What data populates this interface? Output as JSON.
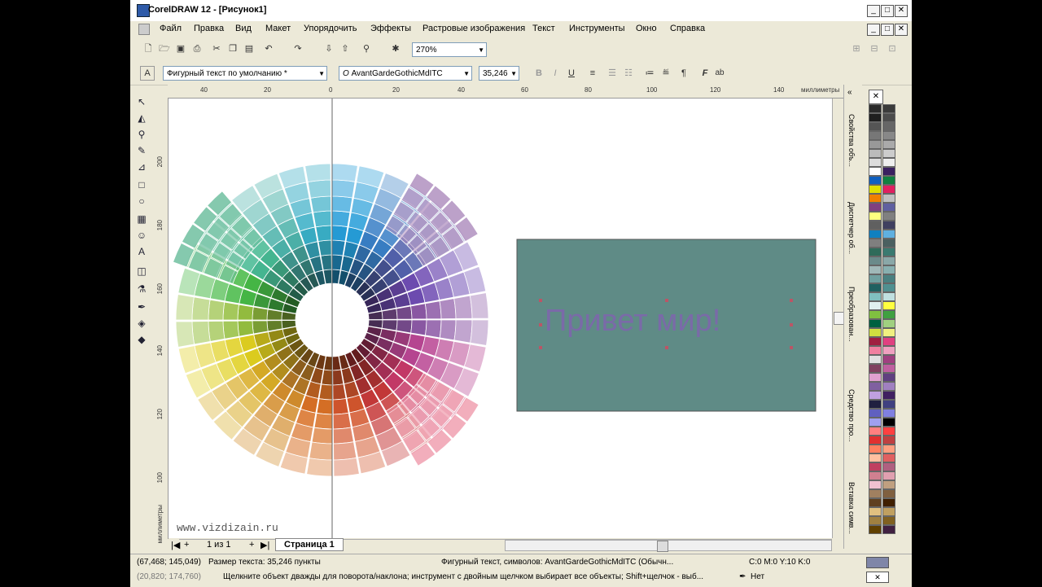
{
  "app": {
    "title": "CorelDRAW 12 - [Рисунок1]"
  },
  "menu": [
    "Файл",
    "Правка",
    "Вид",
    "Макет",
    "Упорядочить",
    "Эффекты",
    "Растровые изображения",
    "Текст",
    "Инструменты",
    "Окно",
    "Справка"
  ],
  "toolbar": {
    "zoom": "270%"
  },
  "propbar": {
    "style": "Фигурный текст по умолчанию *",
    "font": "AvantGardeGothicMdITC",
    "size": "35,246",
    "bold_label": "B",
    "italic_label": "I",
    "underline_label": "U",
    "f_label": "F",
    "ab_label": "ab"
  },
  "rulers": {
    "h_ticks": [
      "40",
      "20",
      "0",
      "20",
      "40",
      "60",
      "80",
      "100",
      "120",
      "140"
    ],
    "h_unit": "миллиметры",
    "v_ticks": [
      "200",
      "180",
      "160",
      "140",
      "120",
      "100"
    ],
    "v_unit": "миллиметры"
  },
  "canvas": {
    "text": "Привет мир!",
    "rect_color": "#5f8b86",
    "text_color": "#7a6aa8",
    "watermark": "www.vizdizain.ru"
  },
  "pages": {
    "counter": "1 из 1",
    "tab": "Страница 1"
  },
  "docker": {
    "tabs": [
      "Свойства объ...",
      "Диспетчер об...",
      "Преобразован...",
      "Средство про...",
      "Вставка симв..."
    ]
  },
  "status": {
    "coords": "(67,468; 145,049)",
    "size": "Размер текста: 35,246 пункты",
    "object": "Фигурный текст, символов: AvantGardeGothicMdITC (Обычн...",
    "color": "C:0 M:0 Y:10 K:0",
    "coords2": "(20,820; 174,760)",
    "hint": "Щелкните объект дважды для поворота/наклона; инструмент с двойным щелчком выбирает все объекты; Shift+щелчок - выб...",
    "outline": "Нет"
  },
  "palette_colors": [
    "#2a2a2a",
    "#3b3b3b",
    "#1f1f1f",
    "#4c4c4c",
    "#555",
    "#666",
    "#777",
    "#888",
    "#999",
    "#aaa",
    "#bbb",
    "#ccc",
    "#ddd",
    "#eee",
    "#fff",
    "#3a2060",
    "#1060c0",
    "#108040",
    "#e0e000",
    "#e02060",
    "#f08000",
    "#c0c0c0",
    "#804080",
    "#6060a0",
    "#ffff80",
    "#808080",
    "#606060",
    "#404060",
    "#1080c0",
    "#60b0e0",
    "#7f7f7f",
    "#4a6060",
    "#2f6b5a",
    "#3a7a70",
    "#6a8a8a",
    "#8aa8a8",
    "#a0b8b8",
    "#88b0b0",
    "#70a0a0",
    "#4a8080",
    "#206060",
    "#509090",
    "#80c0c0",
    "#c0e0e0",
    "#e0f0f0",
    "#ffff40",
    "#80c040",
    "#40a040",
    "#006040",
    "#a0d080",
    "#d0e040",
    "#f0f080",
    "#a02040",
    "#e04080",
    "#f080a0",
    "#f0a0c0",
    "#e0e0e0",
    "#a04080",
    "#804060",
    "#c060a0",
    "#e0a0d0",
    "#604080",
    "#8060a0",
    "#a080c0",
    "#c0a0e0",
    "#402060",
    "#202040",
    "#404080",
    "#6060c0",
    "#8080e0",
    "#a0a0f0",
    "#000000",
    "#ff8080",
    "#ff4040",
    "#e03030",
    "#c04040",
    "#ff8060",
    "#ffa080",
    "#ffc0a0",
    "#e06060",
    "#c04060",
    "#b06080",
    "#d08090",
    "#e0a0b0",
    "#f0c0d0",
    "#c0a080",
    "#a08060",
    "#806040",
    "#604020",
    "#402000",
    "#e0c080",
    "#c0a060",
    "#a08040",
    "#806020",
    "#604000",
    "#402040"
  ]
}
